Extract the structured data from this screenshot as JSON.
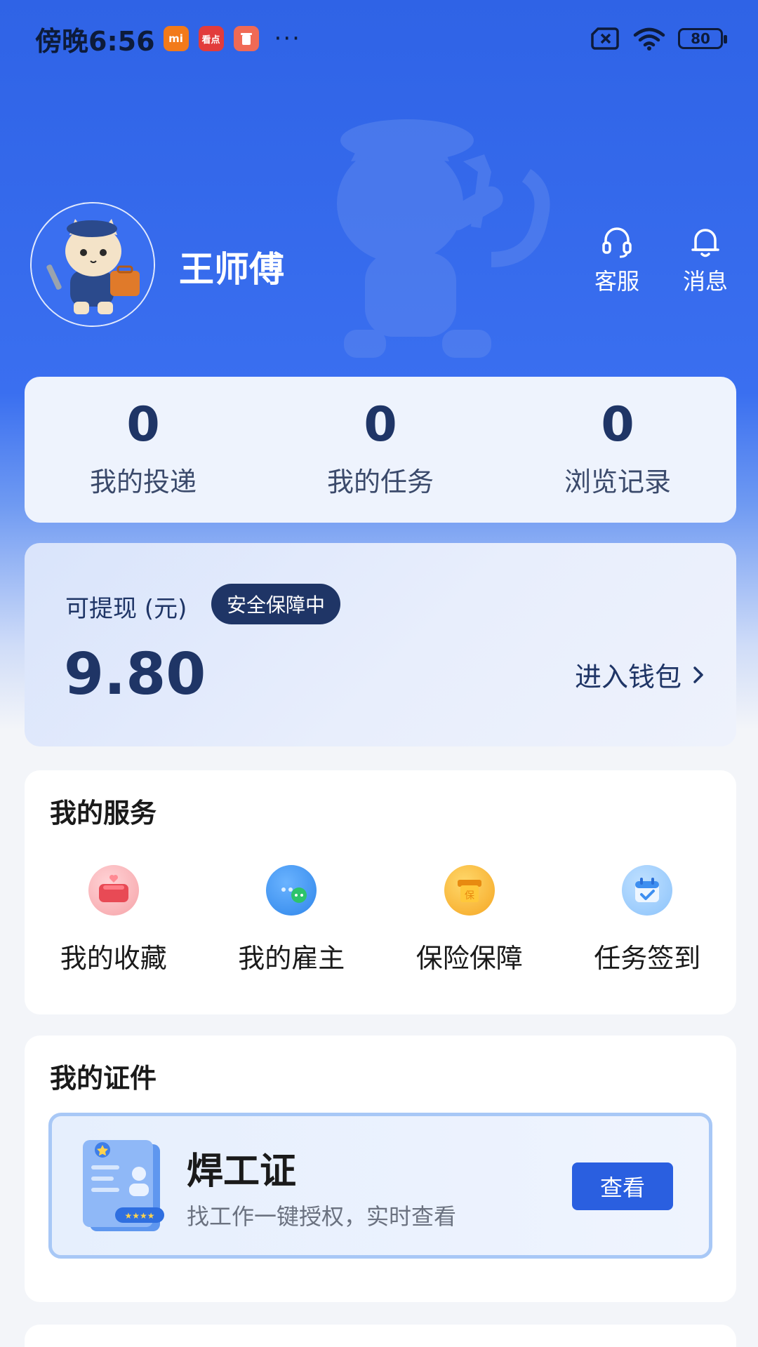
{
  "status_bar": {
    "time": "傍晚6:56",
    "apps": [
      "mi",
      "看点",
      "trash"
    ],
    "more": "···",
    "battery": "80"
  },
  "profile": {
    "name": "王师傅"
  },
  "top_actions": {
    "service_label": "客服",
    "message_label": "消息"
  },
  "stats": [
    {
      "value": "0",
      "label": "我的投递"
    },
    {
      "value": "0",
      "label": "我的任务"
    },
    {
      "value": "0",
      "label": "浏览记录"
    }
  ],
  "wallet": {
    "label": "可提现 (元)",
    "badge": "安全保障中",
    "amount": "9.80",
    "link": "进入钱包"
  },
  "services": {
    "title": "我的服务",
    "items": [
      {
        "label": "我的收藏",
        "icon": "favorites-icon",
        "color": "#ee5a62"
      },
      {
        "label": "我的雇主",
        "icon": "employer-chat-icon",
        "color": "#2f86ea"
      },
      {
        "label": "保险保障",
        "icon": "insurance-icon",
        "color": "#f5a623"
      },
      {
        "label": "任务签到",
        "icon": "calendar-check-icon",
        "color": "#3e8ff0"
      }
    ]
  },
  "certificates": {
    "title": "我的证件",
    "item": {
      "name": "焊工证",
      "desc": "找工作一键授权，实时查看",
      "button": "查看"
    }
  },
  "colors": {
    "primary_blue": "#2f63e6",
    "navy": "#1f3566",
    "button_blue": "#2a5fe0"
  }
}
